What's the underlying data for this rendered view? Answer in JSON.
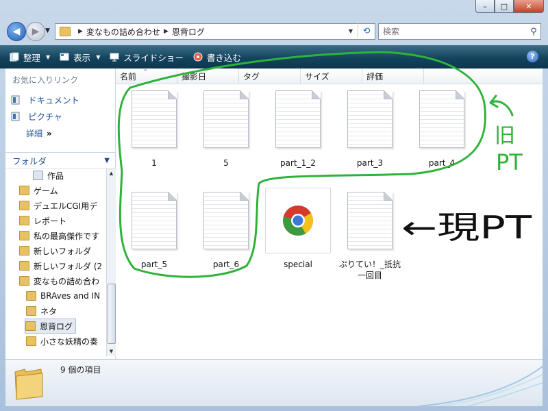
{
  "window": {
    "controls": {
      "minimize": "–",
      "maximize": "□",
      "close": "✕"
    }
  },
  "address": {
    "segments": [
      "変なもの詰め合わせ",
      "恩背ログ"
    ],
    "search_placeholder": "検索"
  },
  "toolbar": {
    "organize": "整理",
    "view": "表示",
    "slideshow": "スライドショー",
    "burn": "書き込む",
    "help": "?"
  },
  "favorites": {
    "title": "お気に入りリンク",
    "items": [
      "ドキュメント",
      "ピクチャ"
    ],
    "more": "詳細",
    "more_glyph": "»"
  },
  "folders": {
    "title": "フォルダ",
    "tree": [
      "作品",
      "ゲーム",
      "デュエルCGI用デ",
      "レポート",
      "私の最高傑作です",
      "新しいフォルダ",
      "新しいフォルダ (2",
      "変なもの詰め合わ",
      "BRAves and IN",
      "ネタ",
      "恩背ログ",
      "小さな妖精の奏"
    ]
  },
  "columns": [
    "名前",
    "撮影日",
    "タグ",
    "サイズ",
    "評価"
  ],
  "files": [
    {
      "name": "1",
      "type": "doc"
    },
    {
      "name": "5",
      "type": "doc"
    },
    {
      "name": "part_1_2",
      "type": "doc"
    },
    {
      "name": "part_3",
      "type": "doc"
    },
    {
      "name": "part_4",
      "type": "doc"
    },
    {
      "name": "part_5",
      "type": "doc"
    },
    {
      "name": "part_6",
      "type": "doc"
    },
    {
      "name": "special",
      "type": "chrome"
    },
    {
      "name": "ぷりてい！_抵抗一回目",
      "type": "doc"
    }
  ],
  "status": {
    "item_count": "9 個の項目"
  },
  "annotations": {
    "label_top_line1": "旧",
    "label_top_line2": "PT",
    "label_right": "←現PT",
    "colors": {
      "green": "#2db33a",
      "black": "#111111"
    }
  }
}
